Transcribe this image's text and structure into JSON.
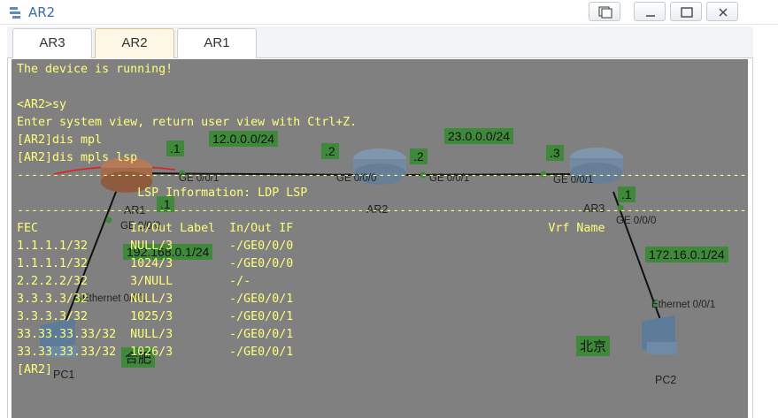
{
  "window": {
    "title": "AR2"
  },
  "tabs": [
    {
      "label": "AR3",
      "active": false
    },
    {
      "label": "AR2",
      "active": true
    },
    {
      "label": "AR1",
      "active": false
    }
  ],
  "terminal": {
    "lines": [
      "The device is running!",
      "",
      "<AR2>sy",
      "Enter system view, return user view with Ctrl+Z.",
      "[AR2]dis mpl",
      "[AR2]dis mpls lsp",
      "-------------------------------------------------------------------------------------------------------",
      "                 LSP Information: LDP LSP",
      "-------------------------------------------------------------------------------------------------------",
      "FEC             In/Out Label  In/Out IF                                    Vrf Name",
      "1.1.1.1/32      NULL/3        -/GE0/0/0",
      "1.1.1.1/32      1024/3        -/GE0/0/0",
      "2.2.2.2/32      3/NULL        -/-",
      "3.3.3.3/32      NULL/3        -/GE0/0/1",
      "3.3.3.3/32      1025/3        -/GE0/0/1",
      "33.33.33.33/32  NULL/3        -/GE0/0/1",
      "33.33.33.33/32  1026/3        -/GE0/0/1",
      "[AR2]"
    ]
  },
  "topology": {
    "devices": {
      "ar1": "AR1",
      "ar2": "AR2",
      "ar3": "AR3",
      "pc1": "PC1",
      "pc2": "PC2"
    },
    "interfaces": {
      "ar1_ge001": "GE 0/0/1",
      "ar1_ge000": "GE 0/0/0",
      "ar2_ge000": "GE 0/0/0",
      "ar2_ge001": "GE 0/0/1",
      "ar3_ge001": "GE 0/0/1",
      "ar3_ge000": "GE 0/0/0",
      "pc1_eth": "Ethernet 0/0/1",
      "pc2_eth": "Ethernet 0/0/1"
    },
    "badges": {
      "ar1_dot1": ".1",
      "net12": "12.0.0.0/24",
      "ar2_dot2a": ".2",
      "ar2_dot2b": ".2",
      "net23": "23.0.0.0/24",
      "ar3_dot3": ".3",
      "ar1_lan_dot1": ".1",
      "lan_hefei": "192.168.0.1/24",
      "ar3_lan_dot1": ".1",
      "lan_beijing": "172.16.0.1/24",
      "city_hefei": "合肥",
      "city_beijing": "北京"
    }
  },
  "colors": {
    "terminal_bg": "#808080",
    "terminal_text": "#ffff7a",
    "badge_bg": "#3f8a3a",
    "link": "#111111",
    "annotation_red": "#e02020"
  }
}
